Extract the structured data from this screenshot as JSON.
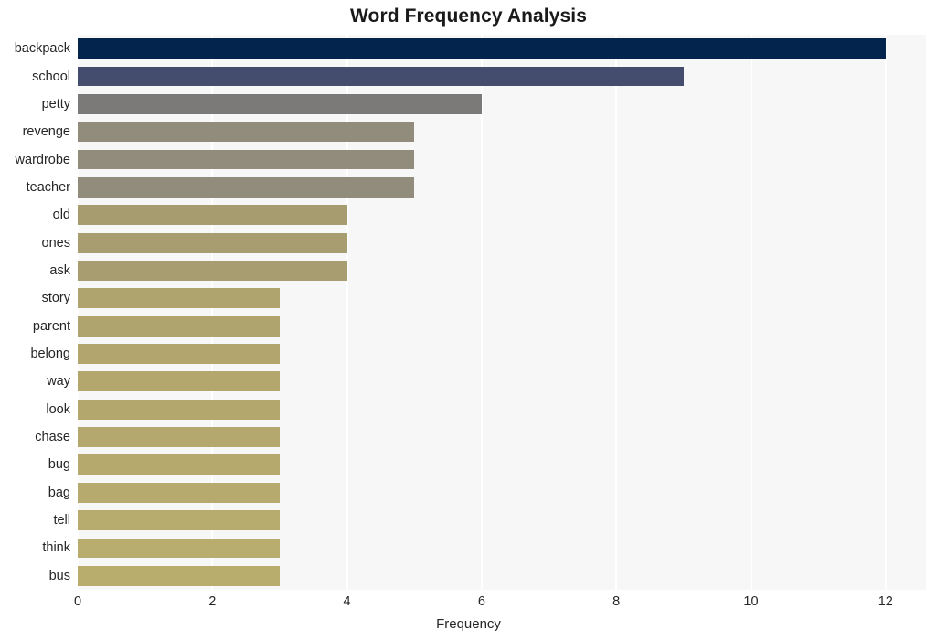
{
  "chart_data": {
    "type": "bar",
    "orientation": "horizontal",
    "title": "Word Frequency Analysis",
    "xlabel": "Frequency",
    "ylabel": "",
    "xlim": [
      0,
      12.6
    ],
    "ylim": null,
    "grid": true,
    "gridlines": "vertical",
    "legend": null,
    "xticks": [
      "0",
      "2",
      "4",
      "6",
      "8",
      "10",
      "12"
    ],
    "xtick_values": [
      0,
      2,
      4,
      6,
      8,
      10,
      12
    ],
    "categories": [
      "backpack",
      "school",
      "petty",
      "revenge",
      "wardrobe",
      "teacher",
      "old",
      "ones",
      "ask",
      "story",
      "parent",
      "belong",
      "way",
      "look",
      "chase",
      "bug",
      "bag",
      "tell",
      "think",
      "bus"
    ],
    "values": [
      12,
      9,
      6,
      5,
      5,
      5,
      4,
      4,
      4,
      3,
      3,
      3,
      3,
      3,
      3,
      3,
      3,
      3,
      3,
      3
    ],
    "bar_colors": [
      "#03244d",
      "#444d6e",
      "#7b7a78",
      "#918c7b",
      "#918c7b",
      "#918c7b",
      "#a69c6f",
      "#a79d70",
      "#a79d70",
      "#b0a46e",
      "#b0a46e",
      "#b2a66e",
      "#b3a76e",
      "#b3a76e",
      "#b4a86e",
      "#b5a96e",
      "#b6aa6e",
      "#b7ab6e",
      "#b8ac6e",
      "#b9ad6e"
    ],
    "plot_background": "#f7f7f7",
    "figure_background": "#ffffff",
    "gridline_color": "#ffffff",
    "text_color": "#262626"
  }
}
